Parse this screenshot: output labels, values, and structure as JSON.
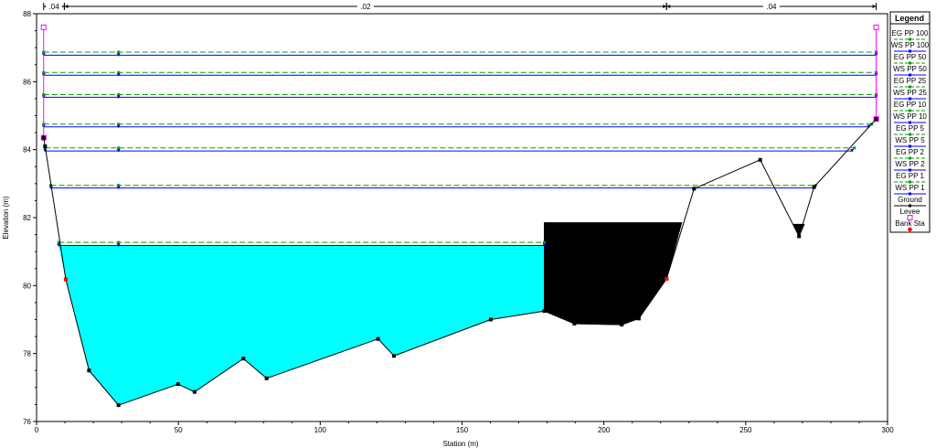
{
  "chart_data": {
    "type": "line",
    "xlabel": "Station (m)",
    "ylabel": "Elevation (m)",
    "xlim": [
      0,
      300
    ],
    "ylim": [
      76,
      88
    ],
    "x_ticks": [
      0,
      50,
      100,
      150,
      200,
      250,
      300
    ],
    "y_ticks": [
      76,
      78,
      80,
      82,
      84,
      86,
      88
    ],
    "grid": false,
    "legend_position": "right",
    "legend_title": "Legend",
    "manning_n": [
      {
        "label": ".04",
        "from": 2.5,
        "to": 9.8
      },
      {
        "label": ".02",
        "from": 9.8,
        "to": 222.1
      },
      {
        "label": ".04",
        "from": 222.1,
        "to": 296
      }
    ],
    "ground": {
      "name": "Ground",
      "x": [
        2.5,
        3.0,
        10.3,
        18.5,
        28.9,
        49.9,
        55.7,
        72.9,
        81.1,
        120.4,
        126.0,
        160.1,
        179.0,
        189.6,
        206.3,
        212.3,
        222.1,
        231.8,
        255.1,
        268.8,
        274.1,
        296.0
      ],
      "y": [
        84.35,
        84.1,
        80.18,
        77.5,
        76.48,
        77.1,
        76.87,
        77.85,
        77.27,
        78.43,
        77.93,
        79.0,
        79.25,
        78.88,
        78.85,
        79.03,
        80.2,
        82.85,
        83.7,
        81.45,
        82.9,
        84.9
      ]
    },
    "ineffective_area": {
      "x": [
        179.0,
        227.4,
        222.1,
        212.3,
        206.3,
        189.6,
        179.0
      ],
      "top": 81.85
    },
    "levees": {
      "name": "Levee",
      "stations": [
        2.5,
        296.0
      ],
      "y_low": [
        84.35,
        84.9
      ],
      "y_top": 87.6,
      "color": "#ff00ff"
    },
    "bank_stations": {
      "name": "Bank Sta",
      "points": [
        [
          10.3,
          80.18
        ],
        [
          222.1,
          80.2
        ]
      ],
      "color": "#ff0000"
    },
    "water_color": "#00ffff",
    "profiles": [
      {
        "name": "EG PP 100",
        "kind": "EG",
        "y": 86.87,
        "x_start": 2.5,
        "x_end": 296.0
      },
      {
        "name": "WS PP 100",
        "kind": "WS",
        "y": 86.78,
        "x_start": 2.5,
        "x_end": 296.0
      },
      {
        "name": "EG PP 50",
        "kind": "EG",
        "y": 86.27,
        "x_start": 2.5,
        "x_end": 296.0
      },
      {
        "name": "WS PP 50",
        "kind": "WS",
        "y": 86.19,
        "x_start": 2.5,
        "x_end": 296.0
      },
      {
        "name": "EG PP 25",
        "kind": "EG",
        "y": 85.62,
        "x_start": 2.5,
        "x_end": 296.0
      },
      {
        "name": "WS PP 25",
        "kind": "WS",
        "y": 85.54,
        "x_start": 2.5,
        "x_end": 296.0
      },
      {
        "name": "EG PP 10",
        "kind": "EG",
        "y": 84.75,
        "x_start": 2.5,
        "x_end": 294.4
      },
      {
        "name": "WS PP 10",
        "kind": "WS",
        "y": 84.67,
        "x_start": 2.5,
        "x_end": 293.4
      },
      {
        "name": "EG PP 5",
        "kind": "EG",
        "y": 84.05,
        "x_start": 3.0,
        "x_end": 288.3
      },
      {
        "name": "WS PP 5",
        "kind": "WS",
        "y": 83.96,
        "x_start": 3.0,
        "x_end": 287.5
      },
      {
        "name": "EG PP 2",
        "kind": "EG",
        "y": 82.95,
        "x_start": 5.0,
        "x_end": 274.6
      },
      {
        "name": "WS PP 2",
        "kind": "WS",
        "y": 82.87,
        "x_start": 5.1,
        "x_end": 274.3
      },
      {
        "name": "EG PP 1",
        "kind": "EG",
        "y": 81.27,
        "x_start": 7.8,
        "x_end": 179.0
      },
      {
        "name": "WS PP 1",
        "kind": "WS",
        "y": 81.18,
        "x_start": 7.8,
        "x_end": 179.0
      }
    ],
    "colors": {
      "EG": "#00a000",
      "WS": "#0000ff",
      "ground": "#000000"
    }
  }
}
